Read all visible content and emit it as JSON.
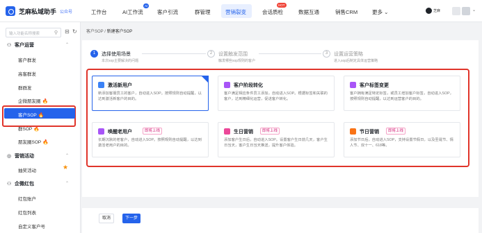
{
  "app": {
    "title": "芝麻私域助手",
    "subtitle": "公众号"
  },
  "nav": {
    "items": [
      "工作台",
      "AI工作流",
      "客户引流",
      "群管理",
      "营销裂变",
      "会话质检",
      "数据互通",
      "销售CRM",
      "更多"
    ],
    "active": "营销裂变",
    "badge_ai": "AI",
    "badge_hot": "HOT",
    "more_caret": "⌄"
  },
  "user": {
    "name": "芝麻"
  },
  "sidebar": {
    "search_placeholder": "输入功能名称搜索",
    "groups": [
      {
        "label": "客户运营",
        "items": [
          "客户群发",
          "高客群发",
          "群群发",
          "企微朋友圈",
          "客户SOP",
          "群SOP",
          "朋友圈SOP"
        ]
      },
      {
        "label": "营销活动",
        "items": [
          "抽奖活动"
        ]
      },
      {
        "label": "企微红包",
        "items": [
          "红包账户",
          "红包列表",
          "自定义客户号"
        ]
      }
    ],
    "active_item": "客户SOP"
  },
  "breadcrumb": {
    "parent": "客户SOP",
    "sep": "/",
    "current": "新建客户SOP"
  },
  "steps": [
    {
      "num": "1",
      "title": "选择使用场景",
      "desc": "本次sop主要解决的问题"
    },
    {
      "num": "2",
      "title": "设置触发范围",
      "desc": "触发哪些sop规则的客户"
    },
    {
      "num": "3",
      "title": "设置运营策略",
      "desc": "进入sop后制定具体运营策略"
    }
  ],
  "cards": [
    {
      "title": "激活新用户",
      "tag": "",
      "desc": "新添加客服员工的客户，自动进入SOP。按照规则自动提醒，以达到激活新客户的目的。",
      "color": "#3b82f6"
    },
    {
      "title": "客户阶段转化",
      "tag": "",
      "desc": "客户满足相应条件员工添加，自动进入SOP。根据标签和关联的客户，达到精细化运营，促进客户转化。",
      "color": "#a855f7"
    },
    {
      "title": "客户标签变更",
      "tag": "",
      "desc": "客户拥有满足特定标签，或员工增加客户标签，自动进入SOP，按照规则自动提醒，以达到运营客户的目的。",
      "color": "#a855f7"
    },
    {
      "title": "唤醒老用户",
      "tag": "即将上线",
      "desc": "长期沉默的老客户，自动进入SOP。按照规则自动提醒，以达到激活老用户的目的。",
      "color": "#a855f7"
    },
    {
      "title": "生日营销",
      "tag": "即将上线",
      "desc": "添加客户生日后，自动进入SOP。设置客户生日前几天，客户生日当天，客户生日当天推送，提升客户体验。",
      "color": "#ec4899"
    },
    {
      "title": "节日营销",
      "tag": "即将上线",
      "desc": "添加节日后，自动进入SOP，支持设置节假日，以及圣诞节、情人节、双十一、618等。",
      "color": "#f97316"
    }
  ],
  "footer": {
    "cancel": "取消",
    "next": "下一步"
  }
}
